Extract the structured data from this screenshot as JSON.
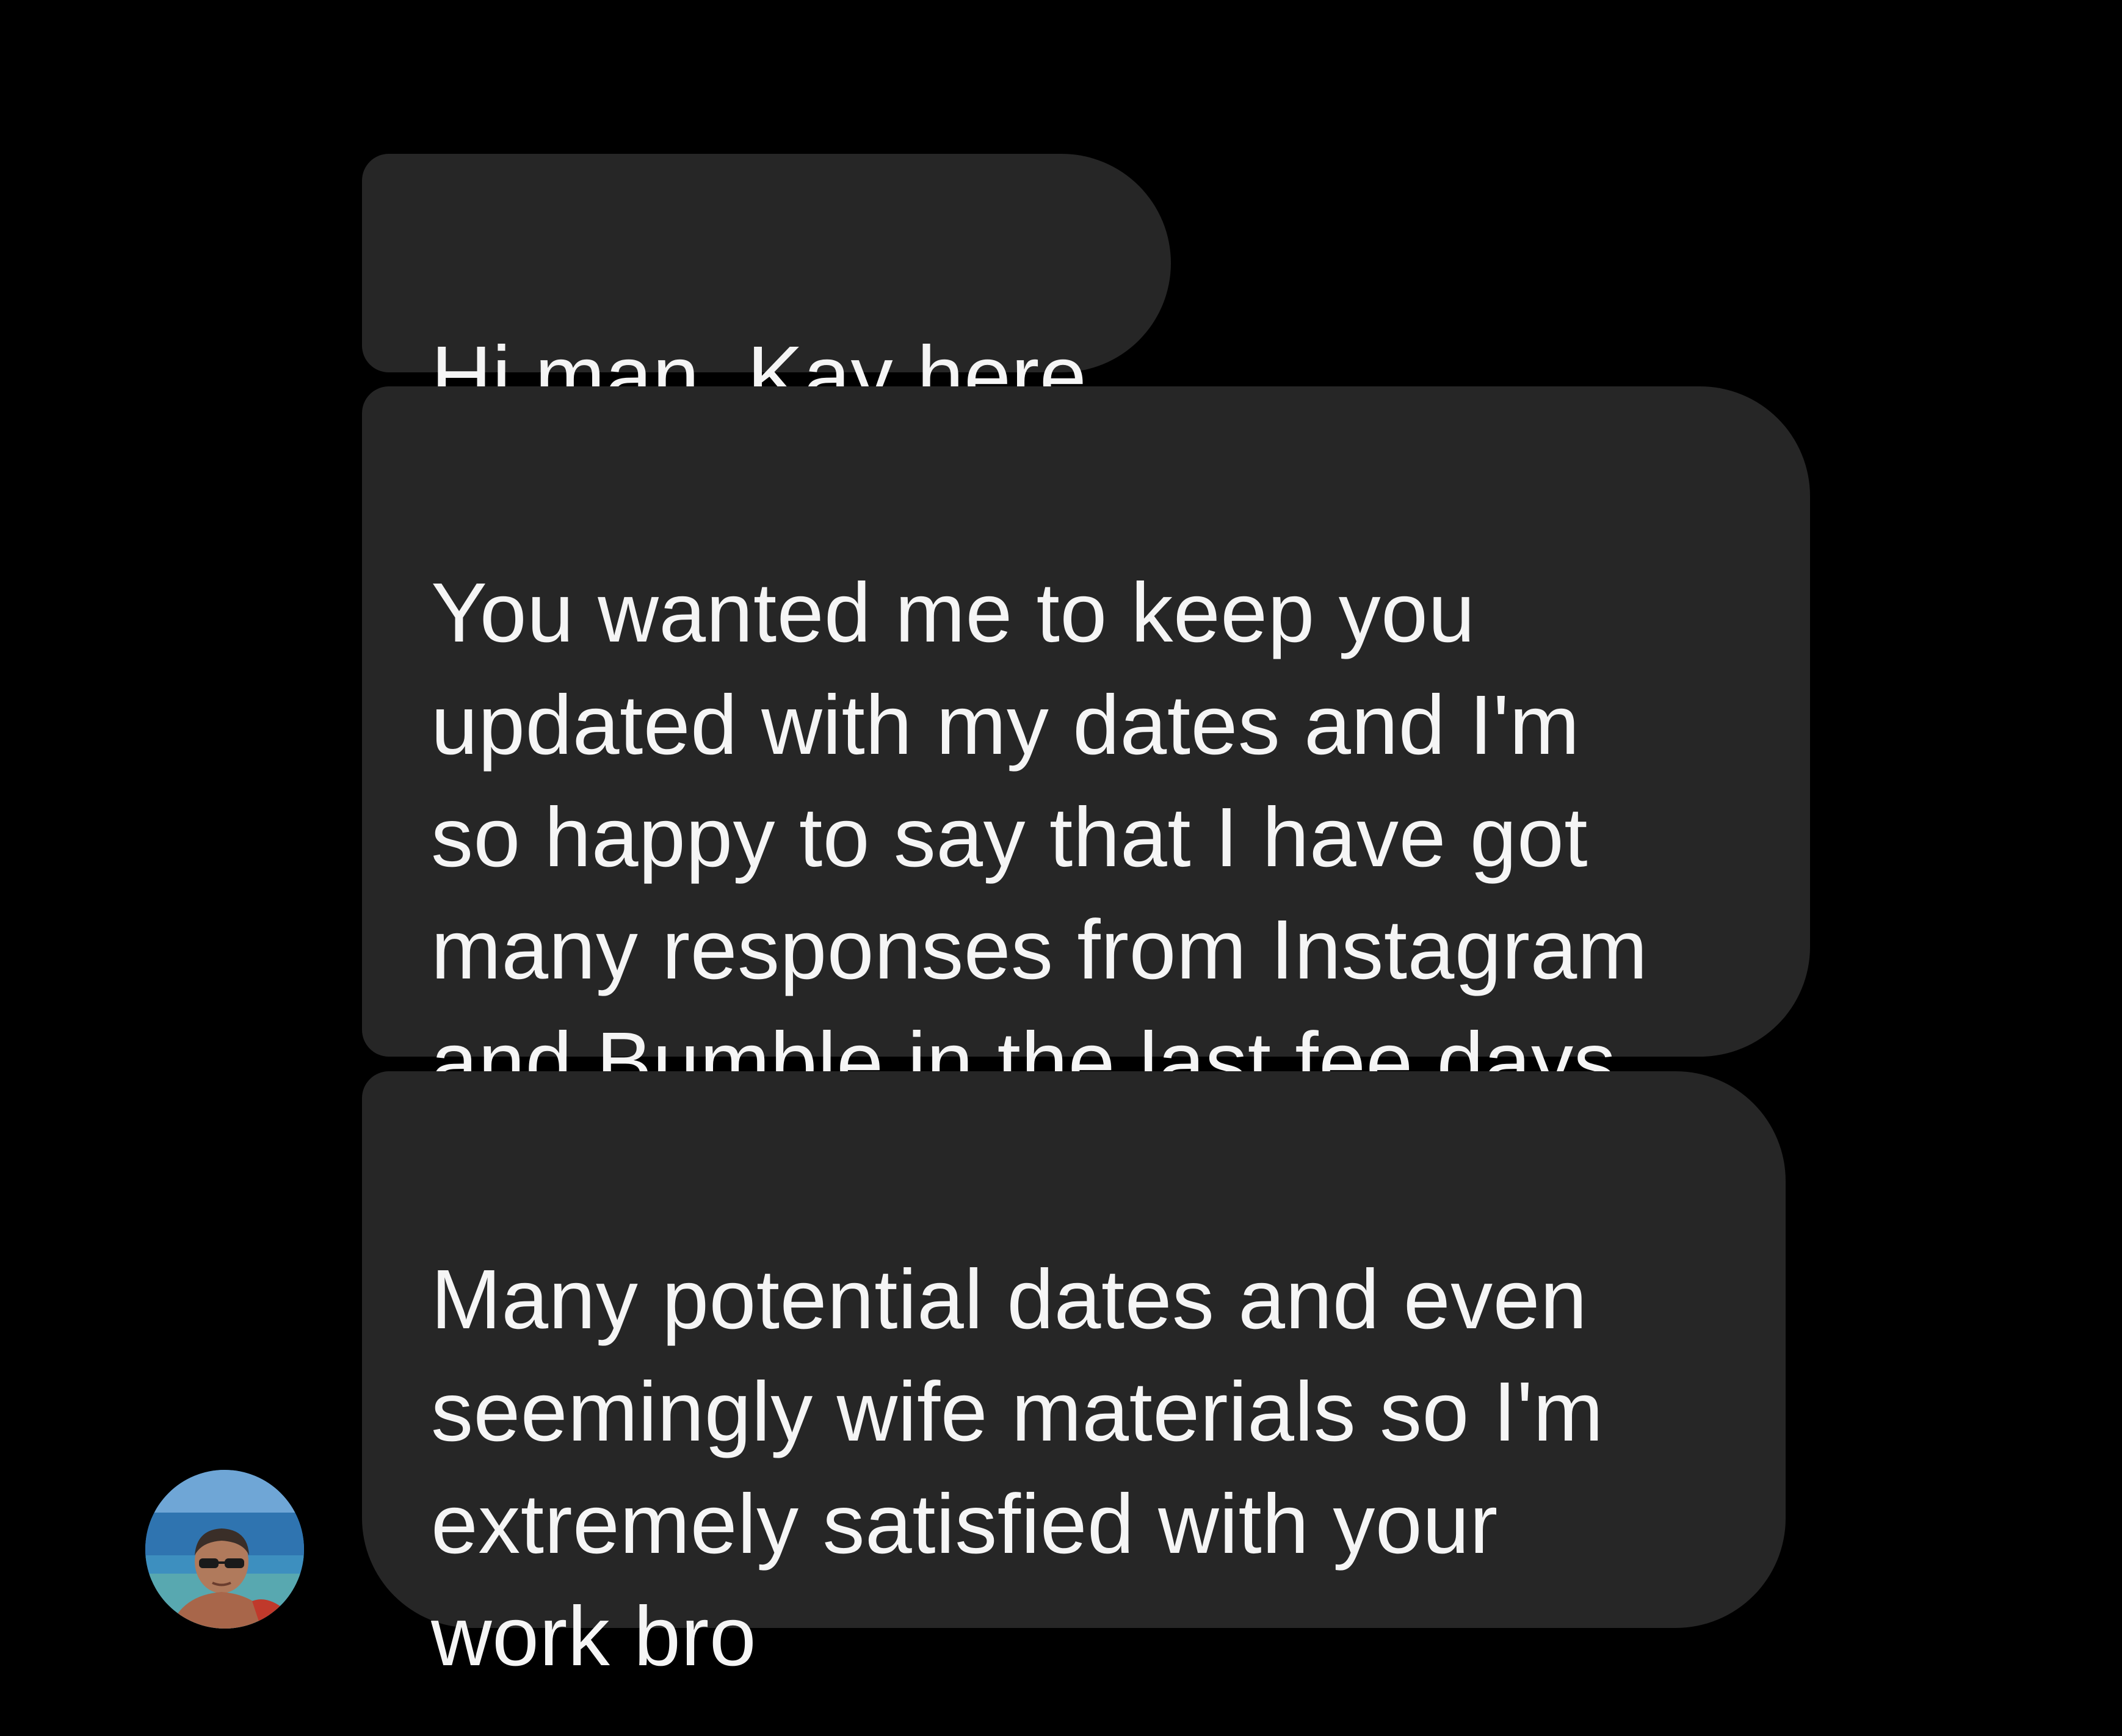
{
  "messages": [
    {
      "text": "Hi man, Kay here"
    },
    {
      "text": "You wanted me to keep you\nupdated with my dates and I'm\nso happy to say that I have got\nmany responses from Instagram\nand Bumble in the last fee days"
    },
    {
      "text": "Many potential dates and even\nseemingly wife materials so I'm\nextremely satisfied with your\nwork bro"
    }
  ],
  "colors": {
    "background": "#000000",
    "bubble": "#262626",
    "text": "#f5f5f5"
  },
  "avatar": {
    "icon": "sender-avatar-photo"
  }
}
